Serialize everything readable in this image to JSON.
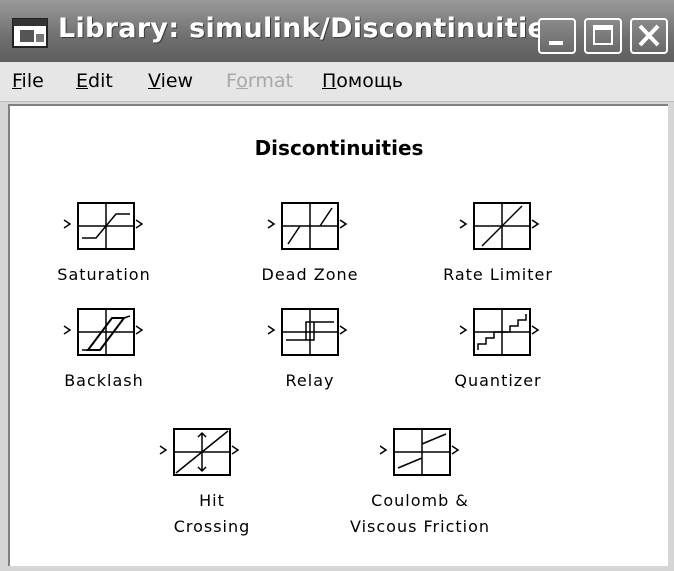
{
  "window": {
    "title": "Library: simulink/Discontinuities"
  },
  "menu": [
    {
      "label": "File",
      "accel": "F",
      "rest": "ile",
      "disabled": false
    },
    {
      "label": "Edit",
      "accel": "E",
      "rest": "dit",
      "disabled": false
    },
    {
      "label": "View",
      "accel": "V",
      "rest": "iew",
      "disabled": false
    },
    {
      "label": "Format",
      "accel": "o",
      "pre": "F",
      "rest": "rmat",
      "disabled": true
    },
    {
      "label": "Помощь",
      "accel": "П",
      "rest": "омощь",
      "disabled": false
    }
  ],
  "library": {
    "title": "Discontinuities",
    "blocks": [
      {
        "id": "saturation",
        "label": "Saturation"
      },
      {
        "id": "dead-zone",
        "label": "Dead Zone"
      },
      {
        "id": "rate-limiter",
        "label": "Rate Limiter"
      },
      {
        "id": "backlash",
        "label": "Backlash"
      },
      {
        "id": "relay",
        "label": "Relay"
      },
      {
        "id": "quantizer",
        "label": "Quantizer"
      },
      {
        "id": "hit-crossing",
        "label_line1": "Hit",
        "label_line2": "Crossing"
      },
      {
        "id": "coulomb",
        "label_line1": "Coulomb &",
        "label_line2": "Viscous Friction"
      }
    ]
  }
}
